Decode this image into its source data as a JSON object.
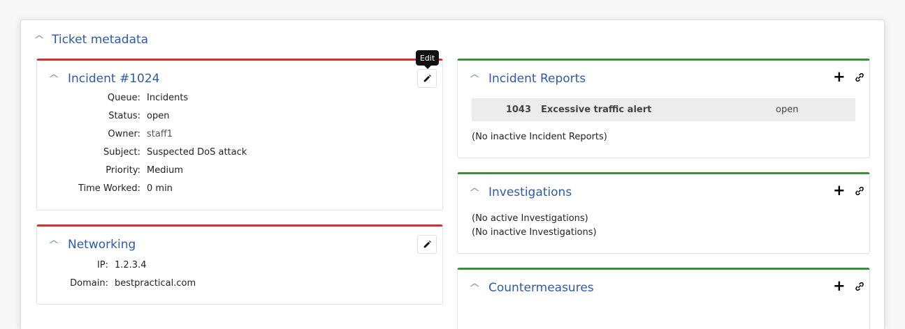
{
  "section": {
    "title": "Ticket metadata"
  },
  "incident": {
    "title": "Incident #1024",
    "edit_tooltip": "Edit",
    "fields": [
      {
        "label": "Queue:",
        "value": "Incidents"
      },
      {
        "label": "Status:",
        "value": "open"
      },
      {
        "label": "Owner:",
        "value": "staff1"
      },
      {
        "label": "Subject:",
        "value": "Suspected DoS attack"
      },
      {
        "label": "Priority:",
        "value": "Medium"
      },
      {
        "label": "Time Worked:",
        "value": "0 min"
      }
    ]
  },
  "networking": {
    "title": "Networking",
    "fields": [
      {
        "label": "IP:",
        "value": "1.2.3.4"
      },
      {
        "label": "Domain:",
        "value": "bestpractical.com"
      }
    ]
  },
  "incident_reports": {
    "title": "Incident Reports",
    "rows": [
      {
        "id": "1043",
        "subject": "Excessive traffic alert",
        "status": "open"
      }
    ],
    "inactive_text": "(No inactive Incident Reports)"
  },
  "investigations": {
    "title": "Investigations",
    "active_text": "(No active Investigations)",
    "inactive_text": "(No inactive Investigations)"
  },
  "countermeasures": {
    "title": "Countermeasures"
  },
  "colors": {
    "title_blue": "#2d5aa6",
    "red_accent": "#cc3333",
    "green_accent": "#3a8f3a"
  },
  "icons": [
    "chevron-up-icon",
    "pencil-icon",
    "plus-icon",
    "link-icon"
  ]
}
